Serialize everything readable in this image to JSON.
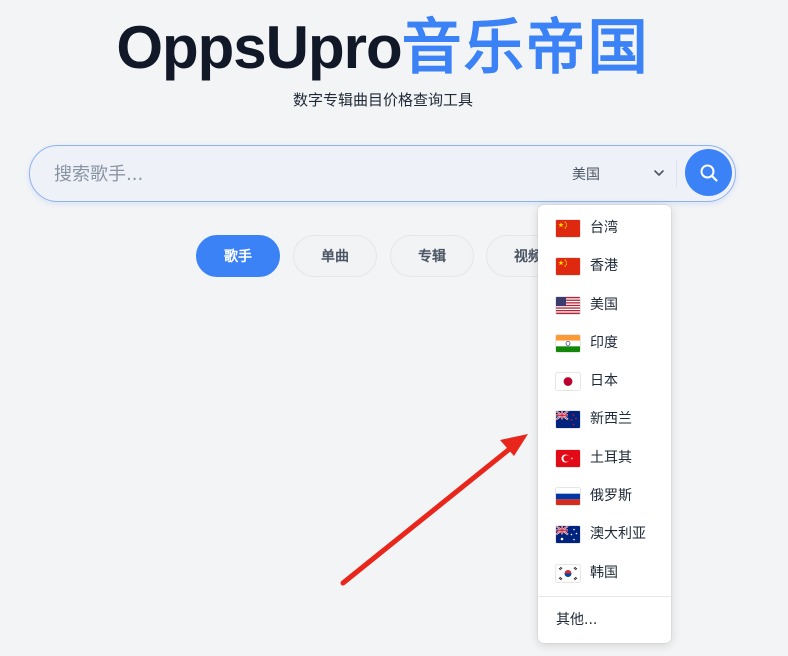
{
  "header": {
    "brand_latin": "OppsUpro",
    "brand_cjk": "音乐帝国",
    "subtitle": "数字专辑曲目价格查询工具"
  },
  "search": {
    "placeholder": "搜索歌手...",
    "region_selected": "美国"
  },
  "tabs": [
    {
      "label": "歌手",
      "active": true
    },
    {
      "label": "单曲",
      "active": false
    },
    {
      "label": "专辑",
      "active": false
    },
    {
      "label": "视频",
      "active": false
    }
  ],
  "region_dropdown": {
    "items": [
      {
        "label": "台湾",
        "flag": "flag-cn-icon"
      },
      {
        "label": "香港",
        "flag": "flag-cn-icon"
      },
      {
        "label": "美国",
        "flag": "flag-us-icon"
      },
      {
        "label": "印度",
        "flag": "flag-in-icon"
      },
      {
        "label": "日本",
        "flag": "flag-jp-icon"
      },
      {
        "label": "新西兰",
        "flag": "flag-nz-icon"
      },
      {
        "label": "土耳其",
        "flag": "flag-tr-icon"
      },
      {
        "label": "俄罗斯",
        "flag": "flag-ru-icon"
      },
      {
        "label": "澳大利亚",
        "flag": "flag-au-icon"
      },
      {
        "label": "韩国",
        "flag": "flag-kr-icon"
      }
    ],
    "other_label": "其他..."
  },
  "colors": {
    "accent": "#3b82f6",
    "annotation_arrow": "#e8261b",
    "background": "#f3f4f6"
  }
}
